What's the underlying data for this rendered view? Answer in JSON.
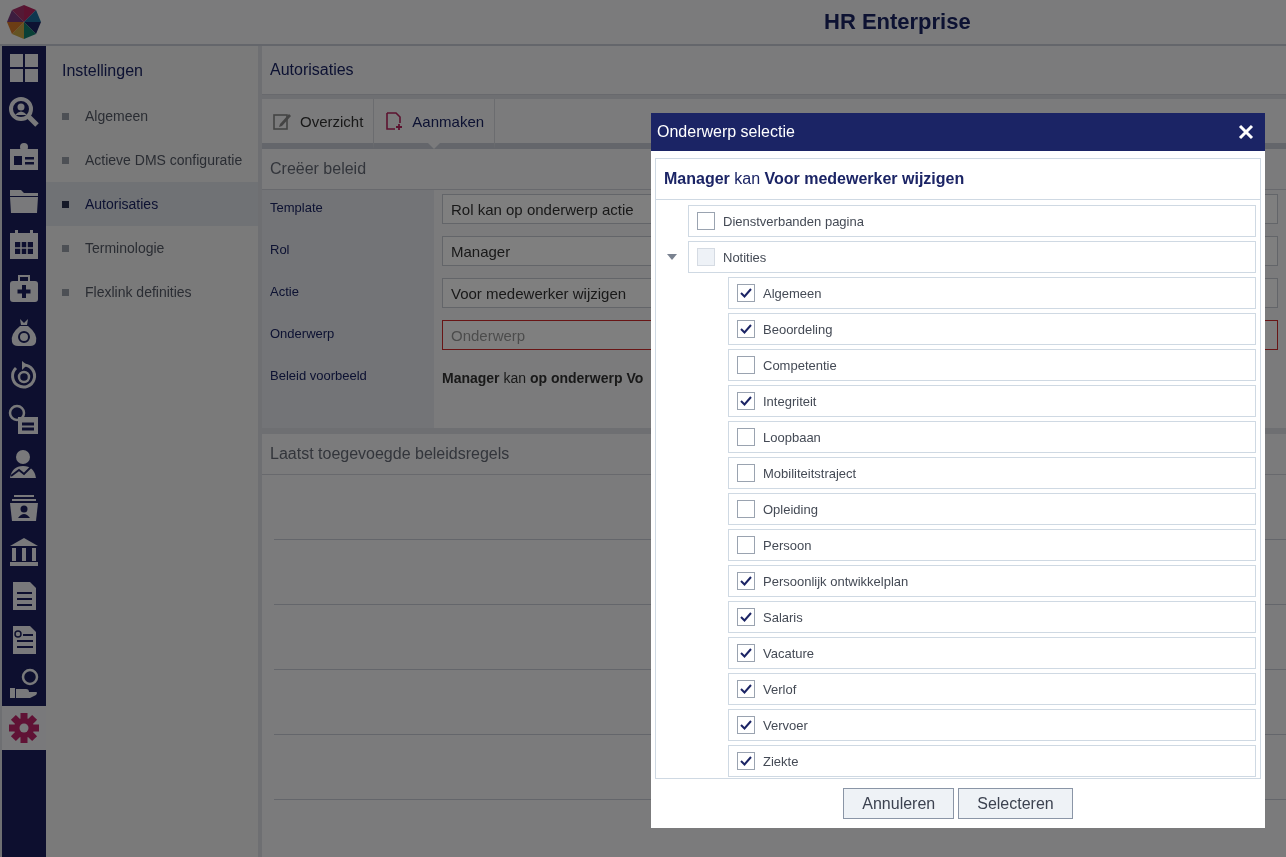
{
  "header": {
    "title": "HR Enterprise"
  },
  "nav_items": [
    {
      "selected": false
    },
    {
      "selected": false
    },
    {
      "selected": false
    },
    {
      "selected": false
    },
    {
      "selected": false
    },
    {
      "selected": false
    },
    {
      "selected": false
    },
    {
      "selected": false
    },
    {
      "selected": false
    },
    {
      "selected": false
    },
    {
      "selected": false
    },
    {
      "selected": false
    },
    {
      "selected": false
    },
    {
      "selected": false
    },
    {
      "selected": false
    },
    {
      "selected": true
    }
  ],
  "sidebar": {
    "title": "Instellingen",
    "items": [
      {
        "label": "Algemeen",
        "selected": false
      },
      {
        "label": "Actieve DMS configuratie",
        "selected": false
      },
      {
        "label": "Autorisaties",
        "selected": true
      },
      {
        "label": "Terminologie",
        "selected": false
      },
      {
        "label": "Flexlink definities",
        "selected": false
      }
    ]
  },
  "page": {
    "title": "Autorisaties"
  },
  "toolbar": [
    {
      "label": "Overzicht",
      "selected": false
    },
    {
      "label": "Aanmaken",
      "selected": true
    }
  ],
  "form": {
    "title": "Creëer beleid",
    "fields": [
      {
        "kind": "select",
        "label": "Template",
        "value": "Rol kan op onderwerp actie"
      },
      {
        "kind": "select",
        "label": "Rol",
        "value": "Manager"
      },
      {
        "kind": "select",
        "label": "Actie",
        "value": "Voor medewerker wijzigen"
      },
      {
        "kind": "input",
        "label": "Onderwerp",
        "placeholder": "Onderwerp",
        "invalid": true
      },
      {
        "kind": "text",
        "label": "Beleid voorbeeld",
        "value": "**Manager** kan **op onderwerp Vo**"
      }
    ]
  },
  "recent": {
    "title": "Laatst toegevoegde beleidsregels"
  },
  "dialog": {
    "title": "Onderwerp selectie",
    "heading": "**Manager** kan **Voor medewerker wijzigen**",
    "tree": [
      {
        "label": "Dienstverbanden pagina",
        "checked": false,
        "partial": false
      },
      {
        "label": "Notities",
        "checked": false,
        "partial": true,
        "expanded": true,
        "children": [
          {
            "label": "Algemeen",
            "checked": true
          },
          {
            "label": "Beoordeling",
            "checked": true
          },
          {
            "label": "Competentie",
            "checked": false
          },
          {
            "label": "Integriteit",
            "checked": true
          },
          {
            "label": "Loopbaan",
            "checked": false
          },
          {
            "label": "Mobiliteitstraject",
            "checked": false
          },
          {
            "label": "Opleiding",
            "checked": false
          },
          {
            "label": "Persoon",
            "checked": false
          },
          {
            "label": "Persoonlijk ontwikkelplan",
            "checked": true
          },
          {
            "label": "Salaris",
            "checked": true
          },
          {
            "label": "Vacature",
            "checked": true
          },
          {
            "label": "Verlof",
            "checked": true
          },
          {
            "label": "Vervoer",
            "checked": true
          },
          {
            "label": "Ziekte",
            "checked": true
          }
        ]
      }
    ],
    "buttons": [
      "Annuleren",
      "Selecteren"
    ]
  }
}
